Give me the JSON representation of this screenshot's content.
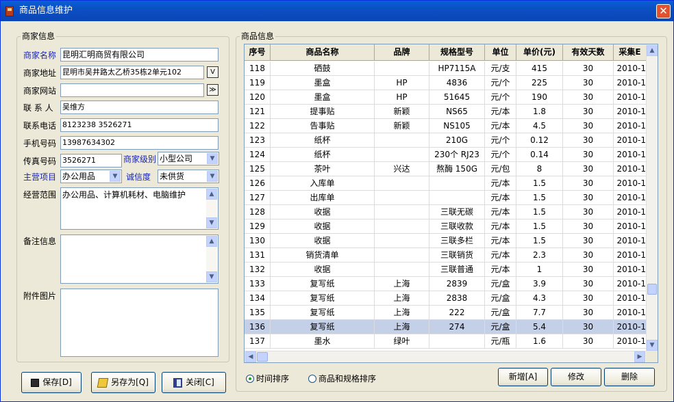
{
  "window": {
    "title": "商品信息维护",
    "close_glyph": "✕"
  },
  "merchant": {
    "group_title": "商家信息",
    "fields": [
      {
        "label": "商家名称",
        "value": "昆明汇明商贸有限公司",
        "highlight": true
      },
      {
        "label": "商家地址",
        "value": "昆明市吴井路太乙桥35栋2单元102",
        "button": "V"
      },
      {
        "label": "商家网站",
        "value": "",
        "button": "≫"
      },
      {
        "label": "联 系 人",
        "value": "吴维方"
      },
      {
        "label": "联系电话",
        "value": "8123238 3526271"
      },
      {
        "label": "手机号码",
        "value": "13987634302"
      },
      {
        "label": "传真号码",
        "value": "3526271"
      }
    ],
    "level_label": "商家级别",
    "level_value": "小型公司",
    "main_label": "主营项目",
    "main_value": "办公用品",
    "credit_label": "诚信度",
    "credit_value": "未供货",
    "scope_label": "经营范围",
    "scope_value": "办公用品、计算机耗材、电脑维护",
    "notes_label": "备注信息",
    "notes_value": "",
    "image_label": "附件图片"
  },
  "buttons": {
    "save": "保存[D]",
    "save_as": "另存为[Q]",
    "close": "关闭[C]",
    "add": "新增[A]",
    "edit": "修改",
    "delete": "删除"
  },
  "product": {
    "group_title": "商品信息",
    "columns": [
      "序号",
      "商品名称",
      "品牌",
      "规格型号",
      "单位",
      "单价(元)",
      "有效天数",
      "采集E"
    ],
    "rows": [
      [
        "118",
        "硒鼓",
        "",
        "HP7115A",
        "元/支",
        "415",
        "30",
        "2010-1"
      ],
      [
        "119",
        "墨盒",
        "HP",
        "4836",
        "元/个",
        "225",
        "30",
        "2010-1"
      ],
      [
        "120",
        "墨盒",
        "HP",
        "51645",
        "元/个",
        "190",
        "30",
        "2010-1"
      ],
      [
        "121",
        "提事贴",
        "新颖",
        "NS65",
        "元/本",
        "1.8",
        "30",
        "2010-1"
      ],
      [
        "122",
        "告事贴",
        "新颖",
        "NS105",
        "元/本",
        "4.5",
        "30",
        "2010-1"
      ],
      [
        "123",
        "纸杯",
        "",
        "210G",
        "元/个",
        "0.12",
        "30",
        "2010-1"
      ],
      [
        "124",
        "纸杯",
        "",
        "230个 RJ23",
        "元/个",
        "0.14",
        "30",
        "2010-1"
      ],
      [
        "125",
        "茶叶",
        "兴达",
        "熬酶 150G",
        "元/包",
        "8",
        "30",
        "2010-1"
      ],
      [
        "126",
        "入库单",
        "",
        "",
        "元/本",
        "1.5",
        "30",
        "2010-1"
      ],
      [
        "127",
        "出库单",
        "",
        "",
        "元/本",
        "1.5",
        "30",
        "2010-1"
      ],
      [
        "128",
        "收据",
        "",
        "三联无碳",
        "元/本",
        "1.5",
        "30",
        "2010-1"
      ],
      [
        "129",
        "收据",
        "",
        "三联收款",
        "元/本",
        "1.5",
        "30",
        "2010-1"
      ],
      [
        "130",
        "收据",
        "",
        "三联多栏",
        "元/本",
        "1.5",
        "30",
        "2010-1"
      ],
      [
        "131",
        "销货清单",
        "",
        "三联销货",
        "元/本",
        "2.3",
        "30",
        "2010-1"
      ],
      [
        "132",
        "收据",
        "",
        "三联普通",
        "元/本",
        "1",
        "30",
        "2010-1"
      ],
      [
        "133",
        "复写纸",
        "上海",
        "2839",
        "元/盒",
        "3.9",
        "30",
        "2010-1"
      ],
      [
        "134",
        "复写纸",
        "上海",
        "2838",
        "元/盒",
        "4.3",
        "30",
        "2010-1"
      ],
      [
        "135",
        "复写纸",
        "上海",
        "222",
        "元/盒",
        "7.7",
        "30",
        "2010-1"
      ],
      [
        "136",
        "复写纸",
        "上海",
        "274",
        "元/盒",
        "5.4",
        "30",
        "2010-1"
      ],
      [
        "137",
        "墨水",
        "绿叶",
        "",
        "元/瓶",
        "1.6",
        "30",
        "2010-1"
      ]
    ],
    "selected_row": 18
  },
  "sort": {
    "by_time": "时间排序",
    "by_name_spec": "商品和规格排序",
    "selected": "by_time"
  },
  "colors": {
    "selection": "#c4d0e8",
    "title_bar": "#0b4fc2",
    "label_blue": "#1b26b3"
  }
}
